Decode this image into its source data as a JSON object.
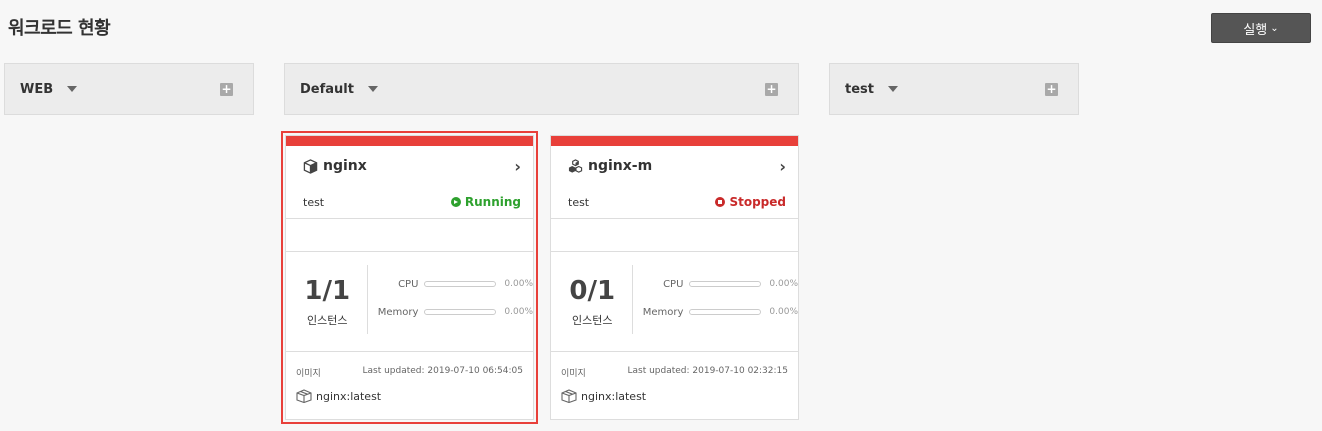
{
  "page": {
    "title": "워크로드 현황"
  },
  "toolbar": {
    "run_label": "실행",
    "run_chevron": "⌄"
  },
  "groups": [
    {
      "name": "WEB",
      "plus": "+"
    },
    {
      "name": "Default",
      "plus": "+"
    },
    {
      "name": "test",
      "plus": "+"
    }
  ],
  "cards": [
    {
      "name": "nginx",
      "icon": "cube-icon",
      "namespace": "test",
      "status": "Running",
      "instances": "1/1",
      "instances_label": "인스턴스",
      "cpu_label": "CPU",
      "cpu_value": "0.00%",
      "cpu_fraction": 0,
      "memory_label": "Memory",
      "memory_value": "0.00%",
      "memory_fraction": 0,
      "image_label": "이미지",
      "last_updated": "Last updated: 2019-07-10 06:54:05",
      "image": "nginx:latest",
      "arrow": "›"
    },
    {
      "name": "nginx-m",
      "icon": "cubes-icon",
      "namespace": "test",
      "status": "Stopped",
      "instances": "0/1",
      "instances_label": "인스턴스",
      "cpu_label": "CPU",
      "cpu_value": "0.00%",
      "cpu_fraction": 0,
      "memory_label": "Memory",
      "memory_value": "0.00%",
      "memory_fraction": 0,
      "image_label": "이미지",
      "last_updated": "Last updated: 2019-07-10 02:32:15",
      "image": "nginx:latest",
      "arrow": "›"
    }
  ],
  "colors": {
    "accent_bar": "#e8403a",
    "running": "#2ea12e",
    "stopped": "#c92a2a",
    "button_bg": "#555555"
  }
}
